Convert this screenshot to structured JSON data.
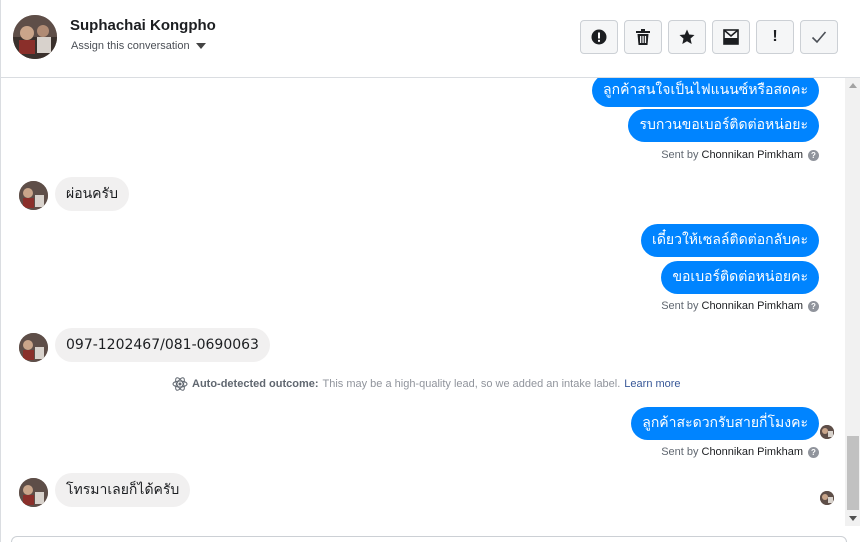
{
  "header": {
    "contact_name": "Suphachai Kongpho",
    "assign_label": "Assign this conversation",
    "toolbar": [
      {
        "name": "spam-button",
        "icon": "alert-circle-icon"
      },
      {
        "name": "delete-button",
        "icon": "trash-icon"
      },
      {
        "name": "star-button",
        "icon": "star-icon"
      },
      {
        "name": "mark-unread-button",
        "icon": "envelope-icon"
      },
      {
        "name": "follow-up-button",
        "icon": "exclamation-icon",
        "text": "!"
      },
      {
        "name": "done-button",
        "icon": "check-icon"
      }
    ]
  },
  "thread": {
    "out_1a": "ลูกค้าสนใจเป็นไฟแนนซ์หรือสดคะ",
    "out_1b": "รบกวนขอเบอร์ติดต่อหน่อยะ",
    "sent_by_1_prefix": "Sent by",
    "sent_by_1_name": "Chonnikan Pimkham",
    "in_1": "ผ่อนครับ",
    "out_2a": "เดี๋ยวให้เซลล์ติดต่อกลับคะ",
    "out_2b": "ขอเบอร์ติดต่อหน่อยคะ",
    "sent_by_2_prefix": "Sent by",
    "sent_by_2_name": "Chonnikan Pimkham",
    "in_2": "097-1202467/081-0690063",
    "auto_note_bold": "Auto-detected outcome:",
    "auto_note_text": "This may be a high-quality lead, so we added an intake label.",
    "auto_note_link": "Learn more",
    "out_3": "ลูกค้าสะดวกรับสายกี่โมงคะ",
    "sent_by_3_prefix": "Sent by",
    "sent_by_3_name": "Chonnikan Pimkham",
    "in_3": "โทรมาเลยก็ได้ครับ"
  },
  "colors": {
    "accent_blue": "#0084ff",
    "incoming_bubble": "#f1f0f0",
    "link": "#385898"
  }
}
